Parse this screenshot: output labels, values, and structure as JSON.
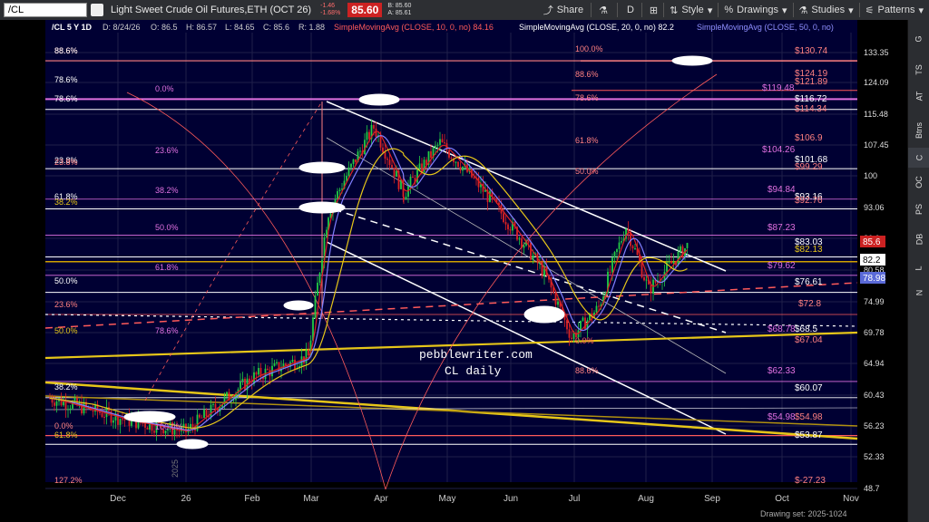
{
  "toolbar": {
    "symbol": "/CL",
    "instrument_title": "Light Sweet Crude Oil Futures,ETH (OCT 26)",
    "change": "-1.46",
    "change_pct": "-1.68%",
    "last_price": "85.60",
    "bid": "B: 85.60",
    "ask": "A: 85.61",
    "share_label": "Share",
    "d_label": "D",
    "style_label": "Style",
    "drawings_label": "Drawings",
    "studies_label": "Studies",
    "patterns_label": "Patterns"
  },
  "right_tabs": [
    "G",
    "TS",
    "AT",
    "Btns",
    "C",
    "OC",
    "PS",
    "DB",
    "L",
    "N"
  ],
  "chart_header": {
    "symbol_info": "/CL 5 Y 1D",
    "date": "D: 8/24/26",
    "open": "O: 86.5",
    "high": "H: 86.57",
    "low": "L: 84.65",
    "close": "C: 85.6",
    "range": "R: 1.88",
    "sma10": "SimpleMovingAvg (CLOSE, 10, 0, no) 84.16",
    "sma20": "SimpleMovingAvg (CLOSE, 20, 0, no) 82.2",
    "sma50": "SimpleMovingAvg (CLOSE, 50, 0, no)"
  },
  "watermark": {
    "line1": "pebblewriter.com",
    "line2": "CL daily"
  },
  "colors": {
    "background": "#000033",
    "up": "#22cc44",
    "down": "#dd2222",
    "fib": "#e070e0",
    "fib_red": "#ff5a5a",
    "sma50": "#e6c619",
    "sma20": "#8080ff",
    "channel": "#ffffff"
  },
  "price_axis": [
    "133.35",
    "124.09",
    "115.48",
    "107.45",
    "100",
    "93.06",
    "86.6",
    "80.58",
    "74.99",
    "69.78",
    "64.94",
    "60.43",
    "56.23",
    "52.33",
    "48.7"
  ],
  "price_tags": [
    {
      "text": "85.6",
      "bg": "#cc2222",
      "fg": "#ffffff"
    },
    {
      "text": "82.2",
      "bg": "#ffffff",
      "fg": "#000000"
    },
    {
      "text": "78.98",
      "bg": "#5a6ad8",
      "fg": "#ffffff"
    }
  ],
  "time_axis": [
    "Dec",
    "26",
    "Feb",
    "Mar",
    "Apr",
    "May",
    "Jun",
    "Jul",
    "Aug",
    "Sep",
    "Oct",
    "Nov"
  ],
  "footer": {
    "drawing_set": "Drawing set: 2025-1024"
  },
  "fib_labels_left": [
    "88.6%",
    "88.6%",
    "78.6%",
    "78.6%",
    "23.8%",
    "23.8%",
    "61.8%",
    "38.2%",
    "50.0%",
    "23.6%",
    "50.0%",
    "38.2%",
    "0.0%",
    "61.8%",
    "127.2%"
  ],
  "fib_labels_mid": [
    "0.0%",
    "23.6%",
    "38.2%",
    "50.0%",
    "61.8%",
    "78.6%",
    "100.0%"
  ],
  "fib_labels_right": [
    "100.0%",
    "88.6%",
    "78.6%",
    "61.8%",
    "50.0%",
    "0.0%",
    "88.6%"
  ],
  "level_labels": [
    "$130.74",
    "$124.19",
    "$121.89",
    "$119.48",
    "$116.72",
    "$114.34",
    "$106.9",
    "$104.26",
    "$101.68",
    "$99.29",
    "$94.84",
    "$93.16",
    "$92.76",
    "$87.23",
    "$83.03",
    "$82.13",
    "$79.62",
    "$76.61",
    "$72.8",
    "$68.78",
    "$68.5",
    "$67.04",
    "$62.33",
    "$60.07",
    "$54.98",
    "$54.98",
    "$53.87",
    "$-27.23"
  ],
  "year_marker": "2025",
  "chart_data": {
    "type": "candlestick",
    "x_labels": [
      "Dec",
      "26",
      "Feb",
      "Mar",
      "Apr",
      "May",
      "Jun",
      "Jul",
      "Aug",
      "Sep",
      "Oct",
      "Nov"
    ],
    "ylim": [
      48.7,
      133.35
    ],
    "y_scale": "log",
    "series": [
      {
        "name": "SimpleMovingAvg (CLOSE, 10, 0, no)",
        "last": 84.16
      },
      {
        "name": "SimpleMovingAvg (CLOSE, 20, 0, no)",
        "last": 82.2
      },
      {
        "name": "SimpleMovingAvg (CLOSE, 50, 0, no)"
      }
    ],
    "last_close": 85.6
  }
}
